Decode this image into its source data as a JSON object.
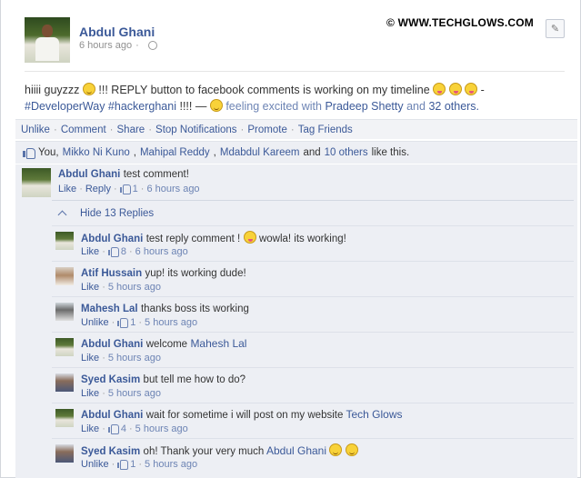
{
  "watermark": "© WWW.TECHGLOWS.COM",
  "post": {
    "author": "Abdul Ghani",
    "time": "6 hours ago",
    "text_part1": "hiiii guyzzz",
    "text_part2": "!!! REPLY button to facebook comments is working on my timeline",
    "text_part3": "-",
    "hashtags": "#DeveloperWay #hackerghani",
    "text_part4": "!!!! —",
    "feeling": "feeling excited with",
    "tagged": "Pradeep Shetty",
    "and": "and",
    "others": "32 others."
  },
  "actions": {
    "unlike": "Unlike",
    "comment": "Comment",
    "share": "Share",
    "stop": "Stop Notifications",
    "promote": "Promote",
    "tag": "Tag Friends"
  },
  "likes": {
    "you": "You,",
    "p1": "Mikko Ni Kuno",
    "p2": "Mahipal Reddy",
    "p3": "Mdabdul Kareem",
    "and": "and",
    "others": "10 others",
    "tail": "like this."
  },
  "main_comment": {
    "name": "Abdul Ghani",
    "text": "test comment!",
    "like": "Like",
    "reply": "Reply",
    "likes": "1",
    "time": "6 hours ago"
  },
  "hide_replies": "Hide 13 Replies",
  "replies": [
    {
      "name": "Abdul Ghani",
      "text": "test reply comment !",
      "text2": "wowla! its working!",
      "action": "Like",
      "likes": "8",
      "time": "6 hours ago"
    },
    {
      "name": "Atif Hussain",
      "text": "yup! its working dude!",
      "action": "Like",
      "time": "5 hours ago"
    },
    {
      "name": "Mahesh Lal",
      "text": "thanks boss its working",
      "action": "Unlike",
      "likes": "1",
      "time": "5 hours ago"
    },
    {
      "name": "Abdul Ghani",
      "text": "welcome",
      "mention": "Mahesh Lal",
      "action": "Like",
      "time": "5 hours ago"
    },
    {
      "name": "Syed Kasim",
      "text": "but tell me how to do?",
      "action": "Like",
      "time": "5 hours ago"
    },
    {
      "name": "Abdul Ghani",
      "text": "wait for sometime i will post on my website",
      "mention": "Tech Glows",
      "action": "Like",
      "likes": "4",
      "time": "5 hours ago"
    },
    {
      "name": "Syed Kasim",
      "text": "oh! Thank your very much",
      "mention": "Abdul Ghani",
      "action": "Unlike",
      "likes": "1",
      "time": "5 hours ago"
    }
  ],
  "colors": {
    "link": "#3b5998",
    "panel": "#edeff4",
    "action_bar": "#f2f3f6"
  }
}
